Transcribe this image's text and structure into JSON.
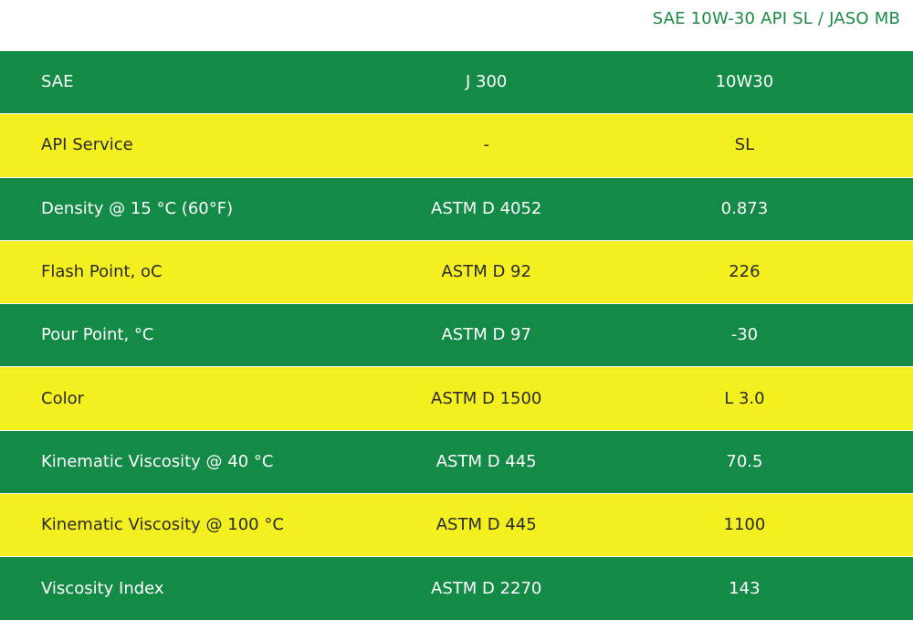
{
  "header": {
    "title": "SAE 10W-30 API SL / JASO MB"
  },
  "rows": [
    {
      "property": "SAE",
      "method": "J 300",
      "value": "10W30",
      "color": "#138a46"
    },
    {
      "property": "API Service",
      "method": "-",
      "value": "SL",
      "color": "#f4f020"
    },
    {
      "property": "Density @ 15 °C  (60°F)",
      "method": "ASTM D 4052",
      "value": "0.873",
      "color": "#138a46"
    },
    {
      "property": "Flash Point, oC",
      "method": "ASTM D 92",
      "value": "226",
      "color": "#f4f020"
    },
    {
      "property": "Pour Point, °C",
      "method": "ASTM D 97",
      "value": "-30",
      "color": "#138a46"
    },
    {
      "property": "Color",
      "method": "ASTM D 1500",
      "value": "L 3.0",
      "color": "#f4f020"
    },
    {
      "property": "Kinematic Viscosity @ 40 °C",
      "method": "ASTM D 445",
      "value": "70.5",
      "color": "#138a46"
    },
    {
      "property": "Kinematic Viscosity @ 100 °C",
      "method": "ASTM D 445",
      "value": "1100",
      "color": "#f4f020"
    },
    {
      "property": "Viscosity Index",
      "method": "ASTM D 2270",
      "value": "143",
      "color": "#138a46"
    }
  ]
}
